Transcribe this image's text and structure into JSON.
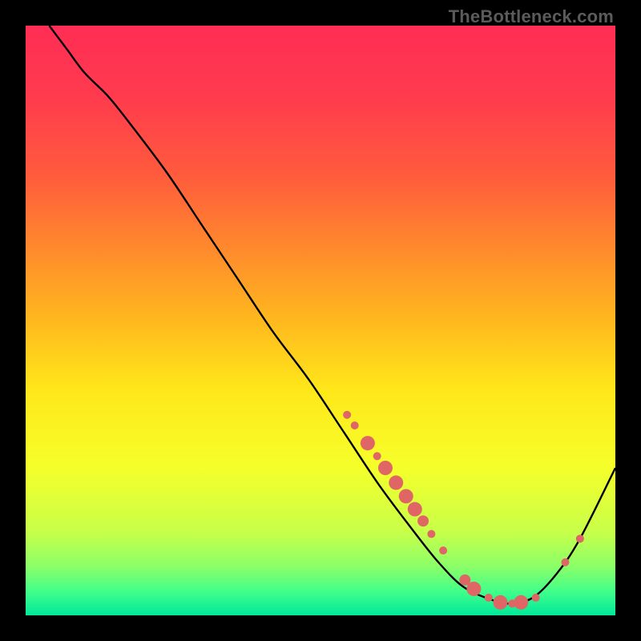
{
  "watermark": "TheBottleneck.com",
  "chart_data": {
    "type": "line",
    "title": "",
    "xlabel": "",
    "ylabel": "",
    "xlim": [
      0,
      100
    ],
    "ylim": [
      0,
      100
    ],
    "grid": false,
    "legend": false,
    "background_gradient": {
      "stops": [
        {
          "offset": 0.0,
          "color": "#ff2d55"
        },
        {
          "offset": 0.12,
          "color": "#ff3b4e"
        },
        {
          "offset": 0.25,
          "color": "#ff5a3d"
        },
        {
          "offset": 0.38,
          "color": "#ff8a2c"
        },
        {
          "offset": 0.5,
          "color": "#ffb81e"
        },
        {
          "offset": 0.62,
          "color": "#ffe81a"
        },
        {
          "offset": 0.75,
          "color": "#f5ff2a"
        },
        {
          "offset": 0.86,
          "color": "#c7ff4a"
        },
        {
          "offset": 0.92,
          "color": "#87ff6a"
        },
        {
          "offset": 0.96,
          "color": "#40ff8a"
        },
        {
          "offset": 1.0,
          "color": "#00e89a"
        }
      ]
    },
    "series": [
      {
        "name": "bottleneck-curve",
        "color": "#000000",
        "x": [
          4,
          7,
          10,
          14,
          18,
          24,
          30,
          36,
          42,
          48,
          54,
          60,
          66,
          70,
          74,
          78,
          82,
          86,
          90,
          94,
          100
        ],
        "y": [
          100,
          96,
          92,
          88,
          83,
          75,
          66,
          57,
          48,
          40,
          31,
          22,
          14,
          9,
          5,
          3,
          2,
          3,
          7,
          13,
          25
        ]
      }
    ],
    "markers": {
      "name": "highlight-dots",
      "color": "#e06666",
      "points": [
        {
          "x": 54.5,
          "y": 34.0,
          "r": 5
        },
        {
          "x": 55.8,
          "y": 32.2,
          "r": 5
        },
        {
          "x": 58.0,
          "y": 29.2,
          "r": 9
        },
        {
          "x": 59.6,
          "y": 27.0,
          "r": 5
        },
        {
          "x": 61.0,
          "y": 25.0,
          "r": 9
        },
        {
          "x": 62.8,
          "y": 22.5,
          "r": 9
        },
        {
          "x": 64.5,
          "y": 20.2,
          "r": 9
        },
        {
          "x": 66.0,
          "y": 18.0,
          "r": 9
        },
        {
          "x": 67.4,
          "y": 16.0,
          "r": 7
        },
        {
          "x": 68.8,
          "y": 13.8,
          "r": 5
        },
        {
          "x": 70.8,
          "y": 11.0,
          "r": 5
        },
        {
          "x": 74.5,
          "y": 6.0,
          "r": 7
        },
        {
          "x": 76.0,
          "y": 4.5,
          "r": 9
        },
        {
          "x": 78.5,
          "y": 3.0,
          "r": 5
        },
        {
          "x": 80.5,
          "y": 2.2,
          "r": 9
        },
        {
          "x": 82.5,
          "y": 2.0,
          "r": 5
        },
        {
          "x": 84.0,
          "y": 2.2,
          "r": 9
        },
        {
          "x": 86.5,
          "y": 3.0,
          "r": 5
        },
        {
          "x": 91.5,
          "y": 9.0,
          "r": 5
        },
        {
          "x": 94.0,
          "y": 13.0,
          "r": 5
        }
      ]
    }
  }
}
